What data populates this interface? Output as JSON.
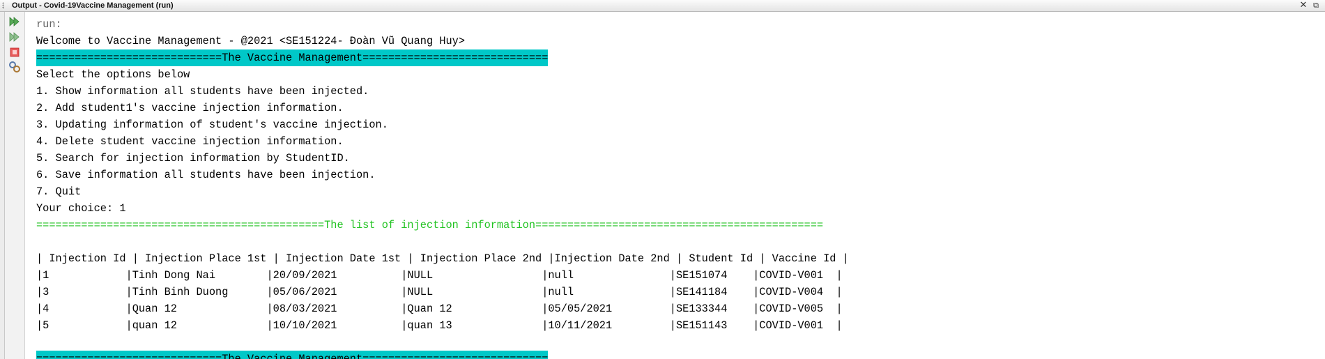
{
  "window": {
    "title": "Output - Covid-19Vaccine Management (run)",
    "close_label": "✕",
    "restore_label": "⧉"
  },
  "toolbar": {
    "icons": [
      "rerun-icon",
      "rerun-with-options-icon",
      "stop-icon",
      "settings-icon"
    ]
  },
  "colors": {
    "banner_bg": "#00c8c8",
    "green_text": "#22c322"
  },
  "console": {
    "run_label": "run:",
    "welcome": "Welcome to Vaccine Management - @2021 <SE151224- Đoàn Vũ Quang Huy>",
    "banner": "=============================The Vaccine Management=============================",
    "prompt": "Select the options below",
    "options": [
      "1. Show information all students have been injected.",
      "2. Add student1's vaccine injection information.",
      "3. Updating information of student's vaccine injection.",
      "4. Delete student vaccine injection information.",
      "5. Search for injection information by StudentID.",
      "6. Save information all students have been injection.",
      "7. Quit"
    ],
    "choice": "Your choice: 1",
    "list_header": "=============================================The list of injection information=============================================",
    "table_header": "| Injection Id | Injection Place 1st | Injection Date 1st | Injection Place 2nd |Injection Date 2nd | Student Id | Vaccine Id |",
    "rows": [
      "|1            |Tinh Dong Nai        |20/09/2021          |NULL                 |null               |SE151074    |COVID-V001  |",
      "|3            |Tinh Binh Duong      |05/06/2021          |NULL                 |null               |SE141184    |COVID-V004  |",
      "|4            |Quan 12              |08/03/2021          |Quan 12              |05/05/2021         |SE133344    |COVID-V005  |",
      "|5            |quan 12              |10/10/2021          |quan 13              |10/11/2021         |SE151143    |COVID-V001  |"
    ],
    "banner_bottom": "=============================The Vaccine Management============================="
  }
}
